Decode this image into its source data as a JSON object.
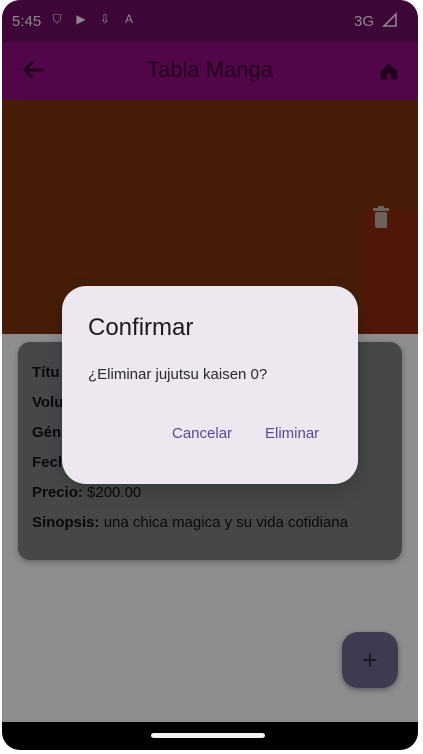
{
  "status": {
    "time": "5:45",
    "network": "3G"
  },
  "appbar": {
    "title": "Tabla Manga"
  },
  "card": {
    "fields": [
      {
        "label": "Títu"
      },
      {
        "label": "Volu"
      },
      {
        "label": "Gén"
      },
      {
        "label": "Fech"
      },
      {
        "label": "Precio:",
        "value": "$200.00"
      },
      {
        "label": "Sinopsis:",
        "value": "una chica magica y su vida cotidiana"
      }
    ]
  },
  "fab": {
    "label": "+"
  },
  "dialog": {
    "title": "Confirmar",
    "message": "¿Eliminar jujutsu kaisen 0?",
    "cancel": "Cancelar",
    "confirm": "Eliminar"
  }
}
